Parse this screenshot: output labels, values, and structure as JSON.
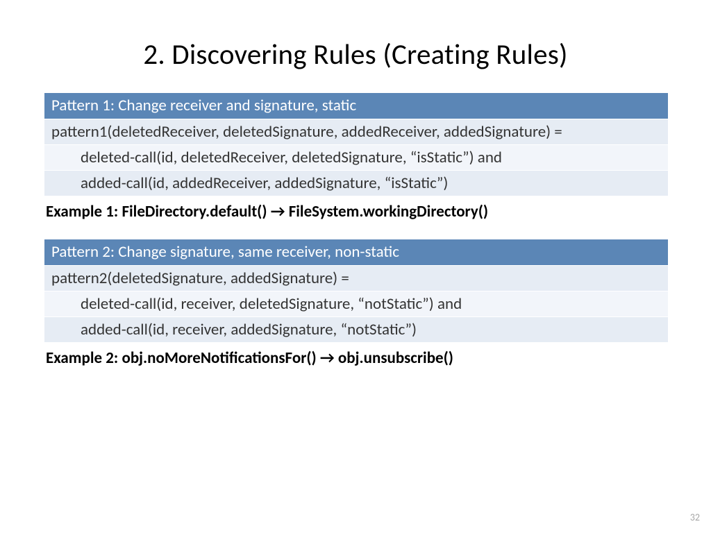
{
  "title": "2. Discovering Rules (Creating Rules)",
  "pattern1": {
    "header": "Pattern 1: Change receiver and signature, static",
    "line1": "pattern1(deletedReceiver, deletedSignature, addedReceiver, addedSignature) =",
    "line2": "deleted-call(id, deletedReceiver, deletedSignature, “isStatic”) and",
    "line3": "added-call(id, addedReceiver, addedSignature, “isStatic”)",
    "example": "Example 1: FileDirectory.default() → FileSystem.workingDirectory()"
  },
  "pattern2": {
    "header": "Pattern 2: Change signature, same receiver, non-static",
    "line1": "pattern2(deletedSignature, addedSignature) =",
    "line2": "deleted-call(id, receiver, deletedSignature, “notStatic”) and",
    "line3": "added-call(id, receiver, addedSignature, “notStatic”)",
    "example": "Example 2: obj.noMoreNotificationsFor() → obj.unsubscribe()"
  },
  "page_number": "32"
}
